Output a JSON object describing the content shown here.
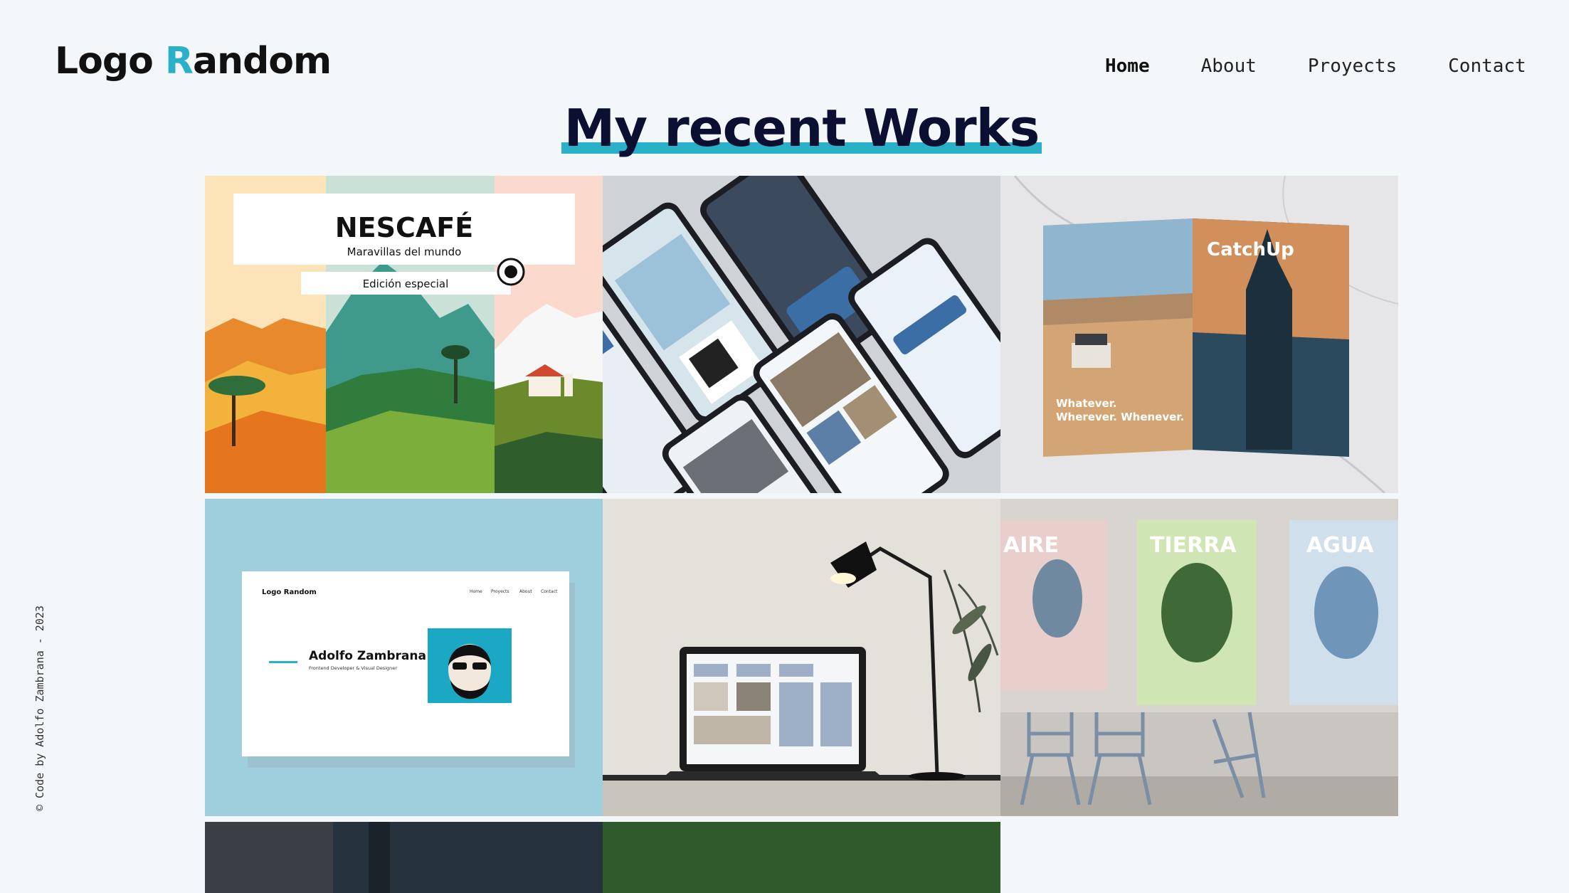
{
  "header": {
    "logo_part1": "Logo ",
    "logo_accent": "R",
    "logo_part2": "andom",
    "nav": [
      "Home",
      "About",
      "Proyects",
      "Contact"
    ],
    "active_nav": "Home"
  },
  "main": {
    "heading": "My recent Works"
  },
  "works": {
    "nescafe": {
      "brand": "NESCAFÉ",
      "subtitle": "Maravillas del mundo",
      "edition": "Edición especial"
    },
    "catchup": {
      "title": "CatchUp",
      "slogan1": "Whatever.",
      "slogan2": "Wherever. Whenever."
    },
    "portfolio": {
      "logo": "Logo Random",
      "name": "Adolfo Zambrana",
      "role": "Frontend Developer & Visual Designer",
      "nav": [
        "Home",
        "Proyects",
        "About",
        "Contact"
      ]
    },
    "posters": [
      "AIRE",
      "TIERRA",
      "AGUA"
    ]
  },
  "footer": {
    "credit": "© Code by Adolfo Zambrana - 2023"
  },
  "colors": {
    "accent": "#2ab1c9",
    "heading": "#0b1033",
    "background": "#f3f7f9"
  }
}
